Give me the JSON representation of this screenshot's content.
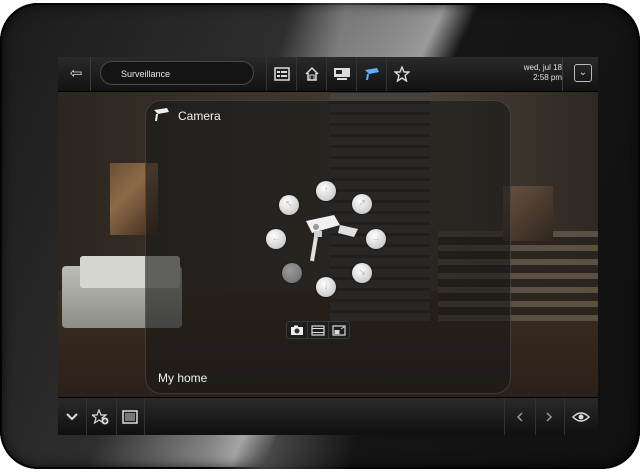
{
  "header": {
    "title": "Surveillance",
    "date": "wed, jul 18",
    "time": "2:58 pm",
    "nav_icons": [
      "list-icon",
      "home-icon",
      "monitor-icon",
      "camera-icon",
      "star-icon"
    ],
    "active_icon": "camera-icon"
  },
  "panel": {
    "title": "Camera",
    "footer": "My home"
  },
  "controls": [
    "ptz-up",
    "ptz-up-right",
    "ptz-right",
    "ptz-down-right",
    "ptz-down",
    "ptz-down-left",
    "ptz-left",
    "ptz-up-left"
  ],
  "modes": [
    "snapshot-icon",
    "film-icon",
    "layout-icon"
  ],
  "footer": {
    "buttons": [
      "chevron-down-icon",
      "favorite-add-icon",
      "window-icon",
      "prev-icon",
      "next-icon",
      "eye-icon"
    ]
  },
  "colors": {
    "accent": "#4aa3ff",
    "text": "#f2f2f2",
    "bar": "#1a1a1a"
  }
}
